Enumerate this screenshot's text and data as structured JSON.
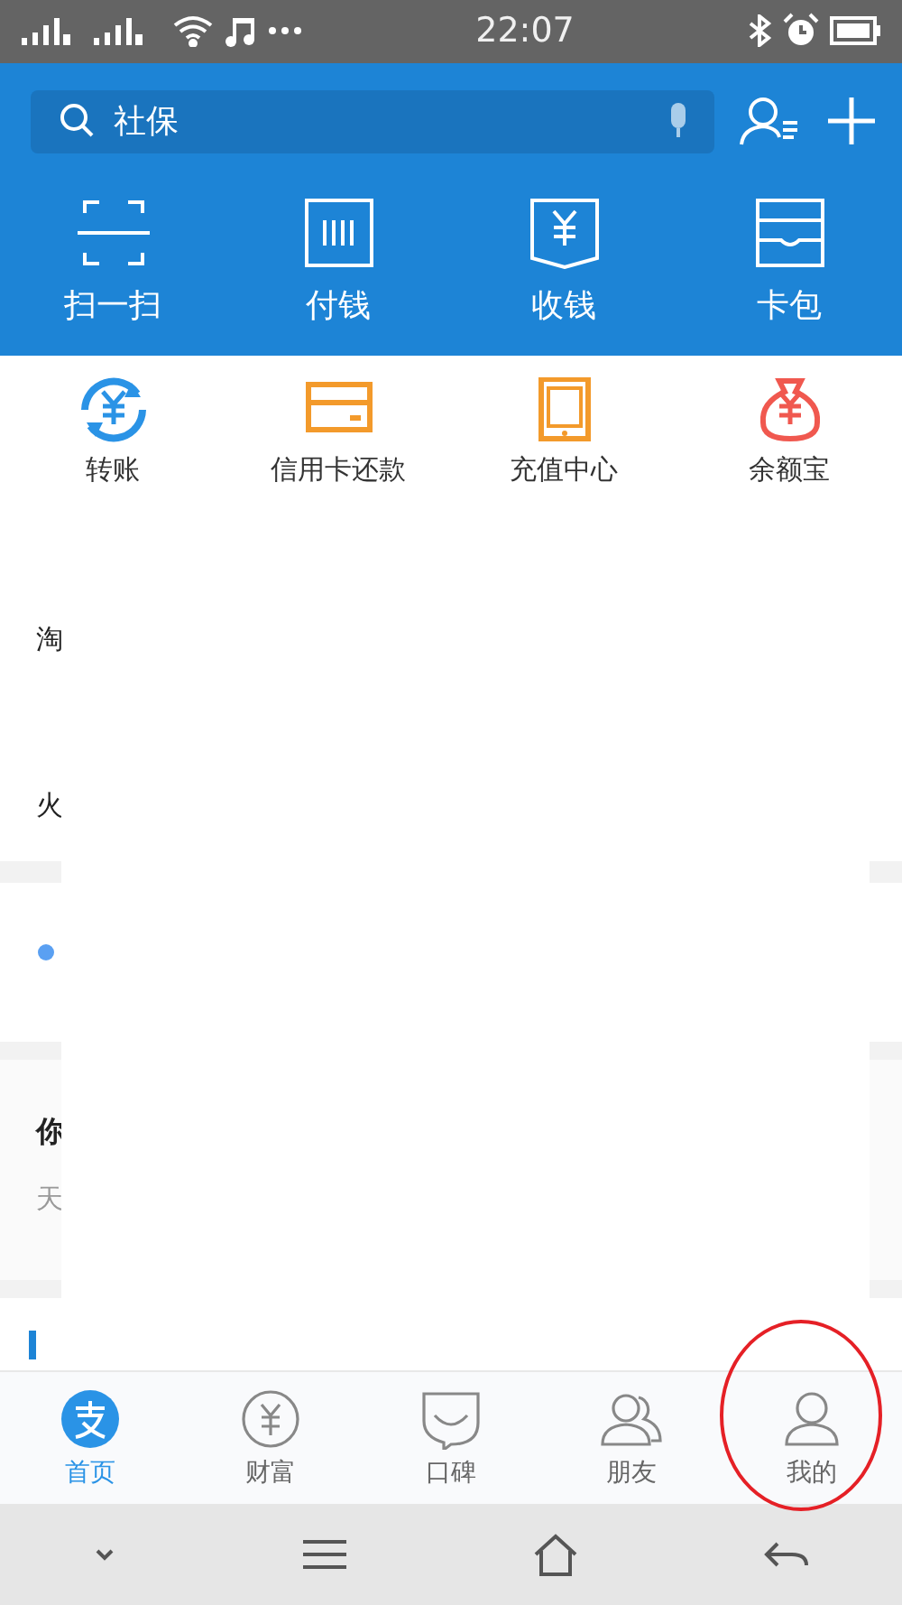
{
  "status_bar": {
    "time": "22:07"
  },
  "search": {
    "value": "社保"
  },
  "quick_actions": [
    {
      "label": "扫一扫",
      "kind": "scan"
    },
    {
      "label": "付钱",
      "kind": "pay"
    },
    {
      "label": "收钱",
      "kind": "receive"
    },
    {
      "label": "卡包",
      "kind": "cards"
    }
  ],
  "services": [
    {
      "label": "转账",
      "kind": "transfer",
      "color": "#2a93e6"
    },
    {
      "label": "信用卡还款",
      "kind": "card",
      "color": "#f39a2b"
    },
    {
      "label": "充值中心",
      "kind": "phone",
      "color": "#f39a2b"
    },
    {
      "label": "余额宝",
      "kind": "bag",
      "color": "#f0584f"
    }
  ],
  "feed_edge": [
    {
      "text": "淘",
      "kind": "item"
    },
    {
      "text": "火",
      "kind": "item"
    },
    {
      "kind": "dot"
    },
    {
      "text": "你",
      "kind": "heading"
    },
    {
      "text": "天",
      "kind": "sub"
    },
    {
      "kind": "bar"
    }
  ],
  "tabs": [
    {
      "label": "首页",
      "kind": "home",
      "selected": true
    },
    {
      "label": "财富",
      "kind": "wealth",
      "selected": false
    },
    {
      "label": "口碑",
      "kind": "koubei",
      "selected": false
    },
    {
      "label": "朋友",
      "kind": "friends",
      "selected": false
    },
    {
      "label": "我的",
      "kind": "me",
      "selected": false
    }
  ]
}
